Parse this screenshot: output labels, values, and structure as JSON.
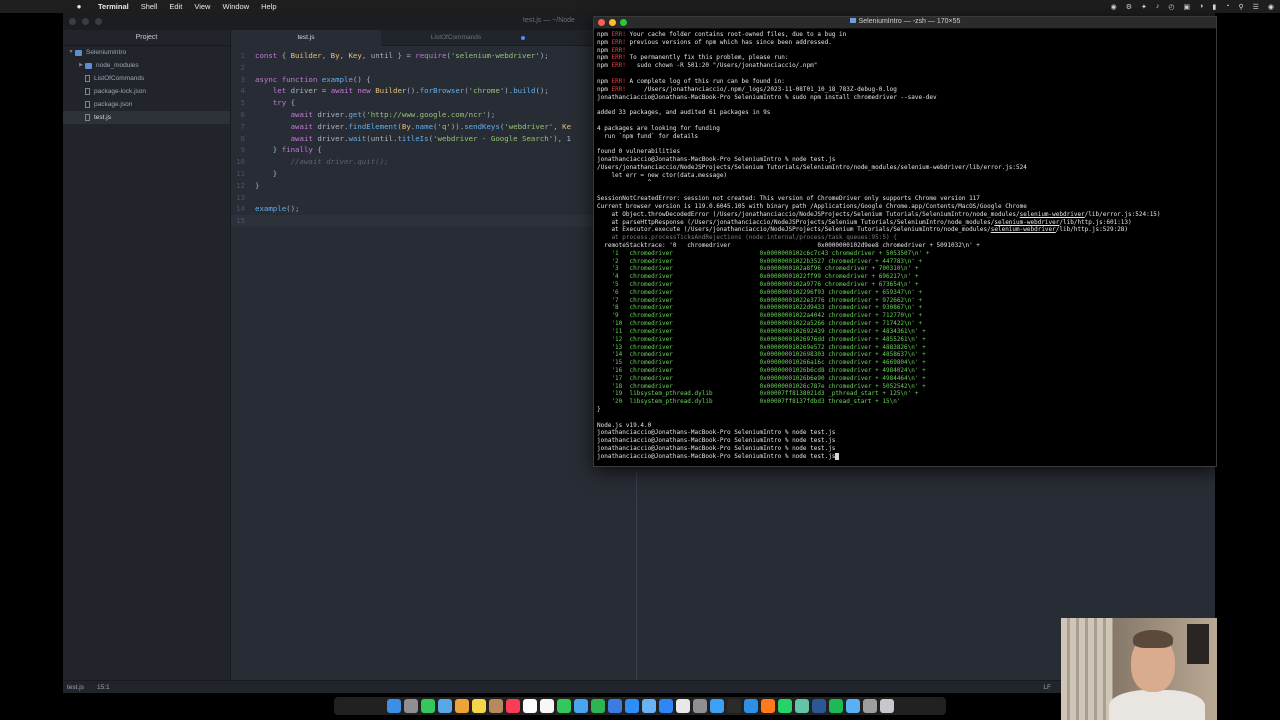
{
  "menubar": {
    "apple": "",
    "app": "Terminal",
    "items": [
      "Shell",
      "Edit",
      "View",
      "Window",
      "Help"
    ]
  },
  "editor": {
    "window_title": "test.js — ~/Node",
    "project_header": "Project",
    "tree": [
      {
        "label": "SeleniumIntro",
        "kind": "folder",
        "open": true,
        "depth": 0
      },
      {
        "label": "node_modules",
        "kind": "folder",
        "open": false,
        "depth": 1
      },
      {
        "label": "ListOfCommands",
        "kind": "file",
        "depth": 1
      },
      {
        "label": "package-lock.json",
        "kind": "file",
        "depth": 1
      },
      {
        "label": "package.json",
        "kind": "file",
        "depth": 1
      },
      {
        "label": "test.js",
        "kind": "file",
        "depth": 1,
        "selected": true
      }
    ],
    "tabs": [
      {
        "label": "test.js",
        "active": true
      },
      {
        "label": "ListOfCommands",
        "active": false,
        "modified": true
      }
    ],
    "lines": [
      "const { Builder, By, Key, until } = require('selenium-webdriver');",
      "",
      "async function example() {",
      "    let driver = await new Builder().forBrowser('chrome').build();",
      "    try {",
      "        await driver.get('http://www.google.com/ncr');",
      "        await driver.findElement(By.name('q')).sendKeys('webdriver', Ke",
      "        await driver.wait(until.titleIs('webdriver - Google Search'), 1",
      "    } finally {",
      "        //await driver.quit();",
      "    }",
      "}",
      "",
      "example();",
      ""
    ],
    "status": {
      "file": "test.js",
      "cursor": "15:1",
      "eol": "LF"
    }
  },
  "terminal": {
    "title": "SeleniumIntro — -zsh — 170×55",
    "lines": [
      {
        "t": "npm ERR! Your cache folder contains root-owned files, due to a bug in",
        "c": "npm"
      },
      {
        "t": "npm ERR! previous versions of npm which has since been addressed.",
        "c": "npm"
      },
      {
        "t": "npm ERR!",
        "c": "npm"
      },
      {
        "t": "npm ERR! To permanently fix this problem, please run:",
        "c": "npm"
      },
      {
        "t": "npm ERR!   sudo chown -R 501:20 \"/Users/jonathanciaccio/.npm\"",
        "c": "npm"
      },
      {
        "t": "",
        "c": ""
      },
      {
        "t": "npm ERR! A complete log of this run can be found in:",
        "c": "npm"
      },
      {
        "t": "npm ERR!     /Users/jonathanciaccio/.npm/_logs/2023-11-08T01_10_18_783Z-debug-0.log",
        "c": "npm"
      },
      {
        "t": "jonathanciaccio@Jonathans-MacBook-Pro SeleniumIntro % sudo npm install chromedriver --save-dev",
        "c": ""
      },
      {
        "t": "",
        "c": ""
      },
      {
        "t": "added 33 packages, and audited 61 packages in 9s",
        "c": ""
      },
      {
        "t": "",
        "c": ""
      },
      {
        "t": "4 packages are looking for funding",
        "c": ""
      },
      {
        "t": "  run `npm fund` for details",
        "c": ""
      },
      {
        "t": "",
        "c": ""
      },
      {
        "t": "found 0 vulnerabilities",
        "c": ""
      },
      {
        "t": "jonathanciaccio@Jonathans-MacBook-Pro SeleniumIntro % node test.js",
        "c": ""
      },
      {
        "t": "/Users/jonathanciaccio/NodeJSProjects/Selenium Tutorials/SeleniumIntro/node_modules/selenium-webdriver/lib/error.js:524",
        "c": ""
      },
      {
        "t": "    let err = new ctor(data.message)",
        "c": ""
      },
      {
        "t": "              ^",
        "c": ""
      },
      {
        "t": "",
        "c": ""
      },
      {
        "t": "SessionNotCreatedError: session not created: This version of ChromeDriver only supports Chrome version 117",
        "c": ""
      },
      {
        "t": "Current browser version is 119.0.6045.105 with binary path /Applications/Google Chrome.app/Contents/MacOS/Google Chrome",
        "c": ""
      },
      {
        "t": "    at Object.throwDecodedError (/Users/jonathanciaccio/NodeJSProjects/Selenium Tutorials/SeleniumIntro/node_modules/selenium-webdriver/lib/error.js:524:15)",
        "c": ""
      },
      {
        "t": "    at parseHttpResponse (/Users/jonathanciaccio/NodeJSProjects/Selenium Tutorials/SeleniumIntro/node_modules/selenium-webdriver/lib/http.js:601:13)",
        "c": ""
      },
      {
        "t": "    at Executor.execute (/Users/jonathanciaccio/NodeJSProjects/Selenium Tutorials/SeleniumIntro/node_modules/selenium-webdriver/lib/http.js:529:28)",
        "c": ""
      },
      {
        "t": "    at process.processTicksAndRejections (node:internal/process/task_queues:95:5) {",
        "c": "dim"
      },
      {
        "t": "  remoteStacktrace: '0   chromedriver                        0x0000000102d9ee8 chromedriver + 5091032\\n' +",
        "c": ""
      },
      {
        "t": "    '1   chromedriver                        0x0000000102c6c7c43 chromedriver + 5053507\\n' +",
        "c": "green"
      },
      {
        "t": "    '2   chromedriver                        0x00000001022b3527 chromedriver + 447783\\n' +",
        "c": "green"
      },
      {
        "t": "    '3   chromedriver                        0x0000000102a8f96 chromedriver + 700310\\n' +",
        "c": "green"
      },
      {
        "t": "    '4   chromedriver                        0x00000001022ff99 chromedriver + 696217\\n' +",
        "c": "green"
      },
      {
        "t": "    '5   chromedriver                        0x0000000102a9776 chromedriver + 673654\\n' +",
        "c": "green"
      },
      {
        "t": "    '6   chromedriver                        0x0000000102296f93 chromedriver + 659347\\n' +",
        "c": "green"
      },
      {
        "t": "    '7   chromedriver                        0x00000001022e3776 chromedriver + 972662\\n' +",
        "c": "green"
      },
      {
        "t": "    '8   chromedriver                        0x00000001022d9433 chromedriver + 930867\\n' +",
        "c": "green"
      },
      {
        "t": "    '9   chromedriver                        0x00000001022a4042 chromedriver + 712770\\n' +",
        "c": "green"
      },
      {
        "t": "    '10  chromedriver                        0x00000001022a5266 chromedriver + 717422\\n' +",
        "c": "green"
      },
      {
        "t": "    '11  chromedriver                        0x0000000102692439 chromedriver + 4834361\\n' +",
        "c": "green"
      },
      {
        "t": "    '12  chromedriver                        0x00000001026976dd chromedriver + 4855261\\n' +",
        "c": "green"
      },
      {
        "t": "    '13  chromedriver                        0x000000010269e572 chromedriver + 4883826\\n' +",
        "c": "green"
      },
      {
        "t": "    '14  chromedriver                        0x0000000102698303 chromedriver + 4858637\\n' +",
        "c": "green"
      },
      {
        "t": "    '15  chromedriver                        0x000000010266a16c chromedriver + 4669804\\n' +",
        "c": "green"
      },
      {
        "t": "    '16  chromedriver                        0x00000001026b6cd8 chromedriver + 4984024\\n' +",
        "c": "green"
      },
      {
        "t": "    '17  chromedriver                        0x00000001026b6e90 chromedriver + 4984464\\n' +",
        "c": "green"
      },
      {
        "t": "    '18  chromedriver                        0x00000001026c787e chromedriver + 5052542\\n' +",
        "c": "green"
      },
      {
        "t": "    '19  libsystem_pthread.dylib             0x00007ff8138021d3 _pthread_start + 125\\n' +",
        "c": "green"
      },
      {
        "t": "    '20  libsystem_pthread.dylib             0x00007ff8137fdbd3 thread_start + 15\\n'",
        "c": "green"
      },
      {
        "t": "}",
        "c": ""
      },
      {
        "t": "",
        "c": ""
      },
      {
        "t": "Node.js v19.4.0",
        "c": ""
      },
      {
        "t": "jonathanciaccio@Jonathans-MacBook-Pro SeleniumIntro % node test.js",
        "c": ""
      },
      {
        "t": "jonathanciaccio@Jonathans-MacBook-Pro SeleniumIntro % node test.js",
        "c": ""
      },
      {
        "t": "jonathanciaccio@Jonathans-MacBook-Pro SeleniumIntro % node test.js",
        "c": ""
      },
      {
        "t": "jonathanciaccio@Jonathans-MacBook-Pro SeleniumIntro % node test.js",
        "c": "cursor"
      }
    ]
  },
  "colors": {
    "terminal_bg": "#000000",
    "terminal_green": "#6bd35a",
    "editor_bg": "#282c34",
    "sidebar_bg": "#21252b",
    "close": "#ff5f57",
    "minimize": "#febc2e",
    "zoom": "#28c840"
  },
  "dock": {
    "icons": [
      "finder-icon",
      "launchpad-icon",
      "messages-icon",
      "maps-icon",
      "photos-icon",
      "notes-icon",
      "contacts-icon",
      "music-icon",
      "calendar-icon",
      "reminders-icon",
      "facetime-icon",
      "mail-icon",
      "numbers-icon",
      "keynote-icon",
      "app-store-icon",
      "preview-icon",
      "safari-icon",
      "chrome-icon",
      "system-settings-icon",
      "xcode-icon",
      "terminal-icon",
      "vscode-icon",
      "firefox-icon",
      "whatsapp-icon",
      "atom-icon",
      "word-icon",
      "spotify-icon",
      "finder-folder-icon",
      "screenshot-icon",
      "trash-icon"
    ]
  }
}
